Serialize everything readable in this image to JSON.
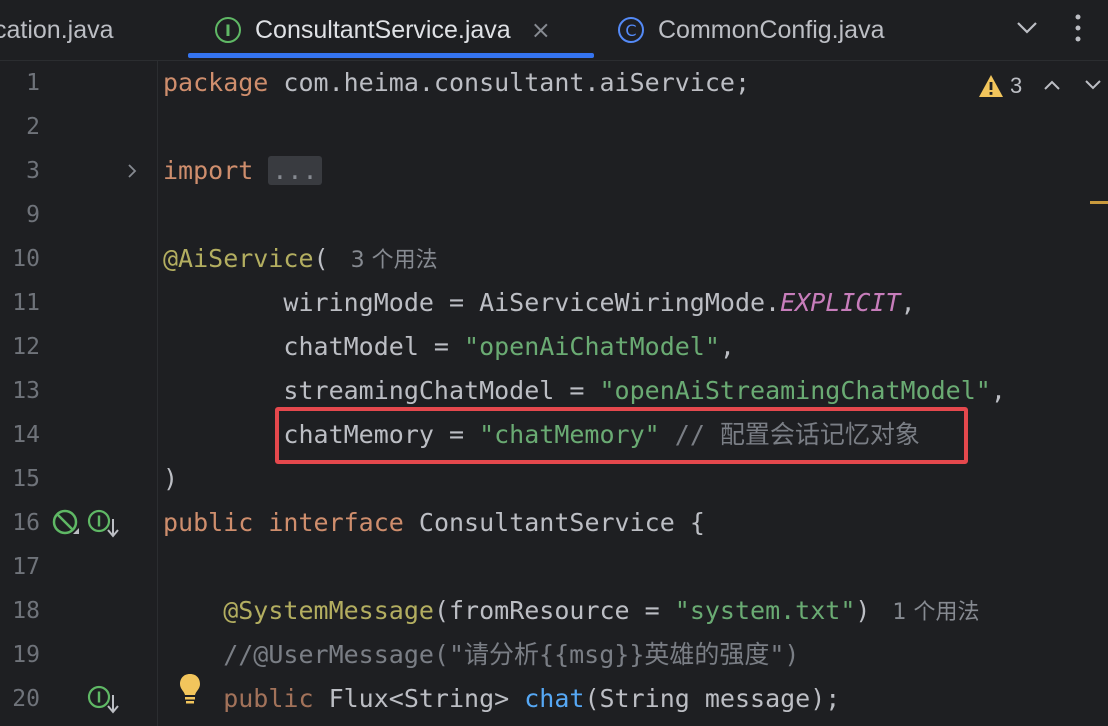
{
  "tabs": [
    {
      "label": "cation.java"
    },
    {
      "label": "ConsultantService.java",
      "icon": "interface-file-icon",
      "icon_letter": "I",
      "close": "×"
    },
    {
      "label": "CommonConfig.java",
      "icon": "class-file-icon",
      "icon_letter": "C"
    }
  ],
  "inspection": {
    "count": "3"
  },
  "comment_label": "// 配置会话记忆对象",
  "lines": {
    "n1": "1",
    "n2": "2",
    "n3": "3",
    "n9": "9",
    "n10": "10",
    "n11": "11",
    "n12": "12",
    "n13": "13",
    "n14": "14",
    "n15": "15",
    "n16": "16",
    "n17": "17",
    "n18": "18",
    "n19": "19",
    "n20": "20"
  },
  "code": {
    "l1_kw": "package",
    "l1_rest": " com.heima.consultant.aiService;",
    "l3_kw": "import",
    "l3_fold": "...",
    "l10_ann": "@AiService",
    "l10_paren": "(",
    "l10_hint": "3 个用法",
    "l11_a": "        wiringMode = AiServiceWiringMode.",
    "l11_const": "EXPLICIT",
    "l11_b": ",",
    "l12_a": "        chatModel = ",
    "l12_str": "\"openAiChatModel\"",
    "l12_b": ",",
    "l13_a": "        streamingChatModel = ",
    "l13_str": "\"openAiStreamingChatModel\"",
    "l13_b": ",",
    "l14_a": "        chatMemory = ",
    "l14_str": "\"chatMemory\"",
    "l15": ")",
    "l16_kw1": "public",
    "l16_kw2": "interface",
    "l16_rest": " ConsultantService {",
    "l18_ann": "    @SystemMessage",
    "l18_a": "(fromResource = ",
    "l18_str": "\"system.txt\"",
    "l18_b": ")",
    "l18_hint": "1 个用法",
    "l19": "    //@UserMessage(\"请分析{{msg}}英雄的强度\")",
    "l20_kw": "    public",
    "l20_a": " Flux<String> ",
    "l20_call": "chat",
    "l20_b": "(String message);"
  },
  "colors": {
    "background": "#1e1f22",
    "keyword": "#cf8e6d",
    "annotation": "#b3ae60",
    "string": "#6aab73",
    "constant": "#c77dbb",
    "comment": "#7a7e85",
    "method_call": "#56a8f5",
    "highlight_box": "#e5484d",
    "active_tab_indicator": "#3574f0"
  }
}
